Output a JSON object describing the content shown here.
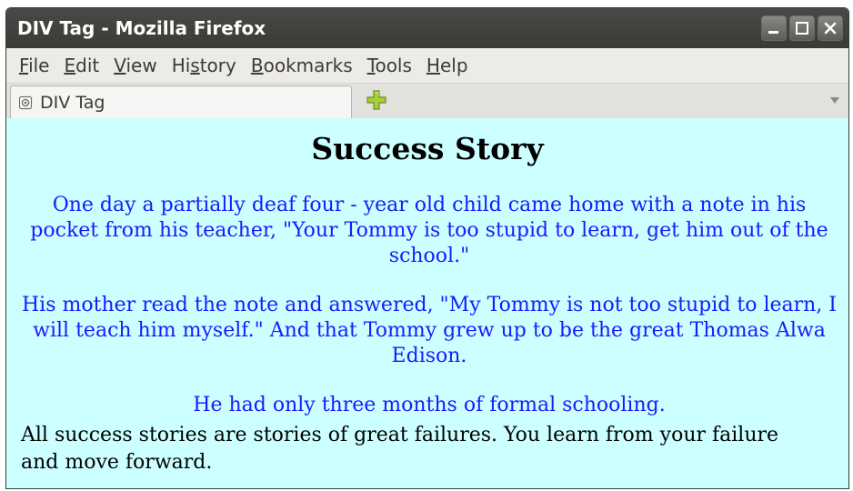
{
  "window": {
    "title": "DIV Tag - Mozilla Firefox"
  },
  "menu": {
    "items": [
      {
        "pre": "",
        "key": "F",
        "post": "ile"
      },
      {
        "pre": "",
        "key": "E",
        "post": "dit"
      },
      {
        "pre": "",
        "key": "V",
        "post": "iew"
      },
      {
        "pre": "Hi",
        "key": "s",
        "post": "tory"
      },
      {
        "pre": "",
        "key": "B",
        "post": "ookmarks"
      },
      {
        "pre": "",
        "key": "T",
        "post": "ools"
      },
      {
        "pre": "",
        "key": "H",
        "post": "elp"
      }
    ]
  },
  "tabs": {
    "active_label": "DIV Tag"
  },
  "page": {
    "heading": "Success Story",
    "story_paragraphs": [
      "One day a partially deaf four - year old child came home with a note in his pocket from his teacher, \"Your Tommy is too stupid to learn, get him out of the school.\"",
      "His mother read the note and answered, \"My Tommy is not too stupid to learn, I will teach him myself.\" And that Tommy grew up to be the great Thomas Alwa Edison.",
      "He had only three months of formal schooling."
    ],
    "moral": "All success stories are stories of great failures. You learn from your failure and move forward.",
    "background_color": "#ccffff",
    "story_color": "#1a1aff"
  }
}
